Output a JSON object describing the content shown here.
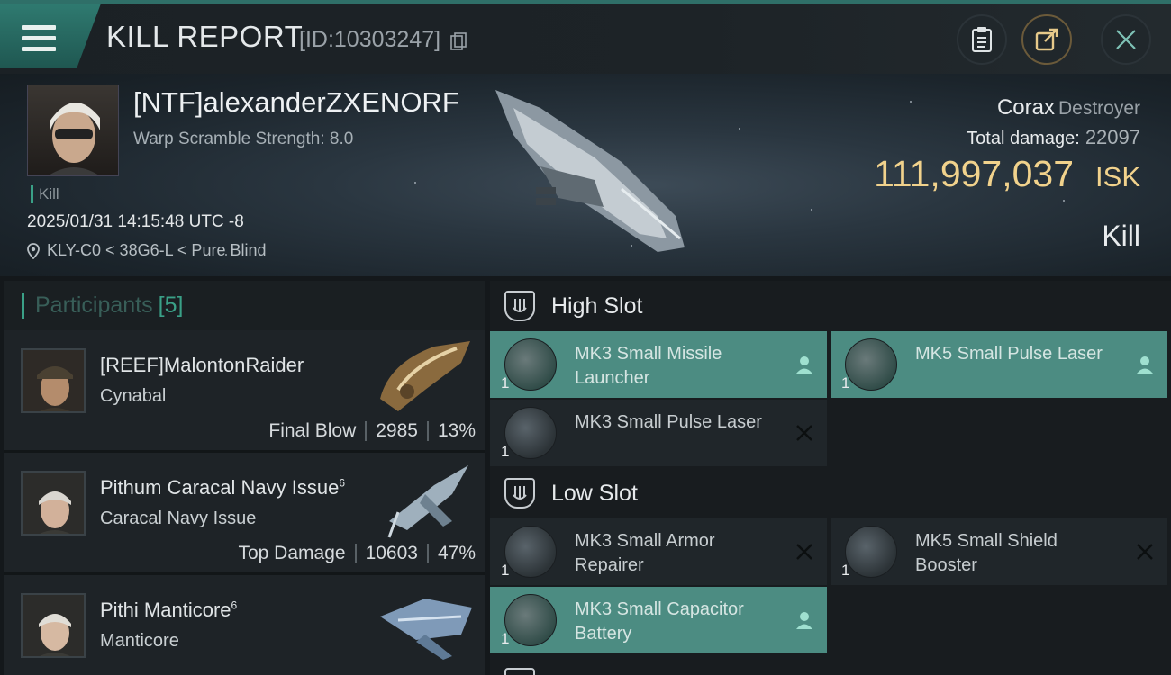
{
  "header": {
    "title": "KILL REPORT",
    "report_id": "[ID:10303247]"
  },
  "victim": {
    "name": "[NTF]alexanderZXENORF",
    "warp_scramble": "Warp Scramble Strength: 8.0",
    "tag": "Kill",
    "datetime": "2025/01/31 14:15:48 UTC -8",
    "location": "KLY-C0 < 38G6-L < Pure Blind"
  },
  "ship": {
    "name": "Corax",
    "class": "Destroyer",
    "total_damage_label": "Total damage:",
    "total_damage": "22097",
    "isk_value": "111,997,037",
    "isk_unit": "ISK",
    "result": "Kill"
  },
  "participants": {
    "label": "Participants",
    "count": "[5]",
    "items": [
      {
        "name": "[REEF]MalontonRaider",
        "level": "",
        "ship": "Cynabal",
        "role": "Final Blow",
        "damage": "2985",
        "percent": "13%"
      },
      {
        "name": "Pithum Caracal Navy Issue",
        "level": "6",
        "ship": "Caracal Navy Issue",
        "role": "Top Damage",
        "damage": "10603",
        "percent": "47%"
      },
      {
        "name": "Pithi Manticore",
        "level": "6",
        "ship": "Manticore",
        "role": "",
        "damage": "",
        "percent": ""
      }
    ]
  },
  "slots": {
    "high": {
      "label": "High Slot",
      "modules": [
        {
          "name": "MK3 Small Missile Launcher",
          "qty": "1",
          "state": "dropped"
        },
        {
          "name": "MK5 Small Pulse Laser",
          "qty": "1",
          "state": "dropped"
        },
        {
          "name": "MK3 Small Pulse Laser",
          "qty": "1",
          "state": "destroyed"
        }
      ]
    },
    "low": {
      "label": "Low Slot",
      "modules": [
        {
          "name": "MK3 Small Armor Repairer",
          "qty": "1",
          "state": "destroyed"
        },
        {
          "name": "MK5 Small Shield Booster",
          "qty": "1",
          "state": "destroyed"
        },
        {
          "name": "MK3 Small Capacitor Battery",
          "qty": "1",
          "state": "dropped"
        }
      ]
    }
  },
  "colors": {
    "accent": "#3aa087",
    "isk": "#f1d28c",
    "active_module": "#4c8c82"
  }
}
